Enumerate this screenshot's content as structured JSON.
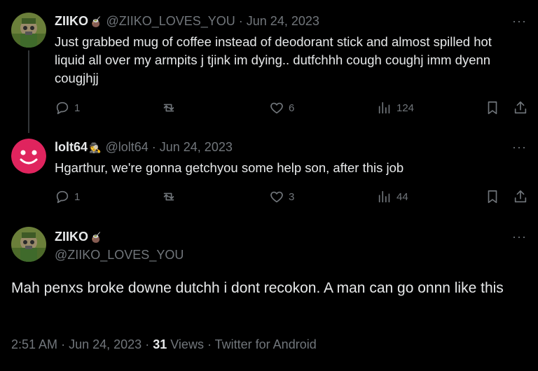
{
  "tweets": [
    {
      "name": "ZIIKO",
      "emoji": "🧉",
      "handle": "@ZIIKO_LOVES_YOU",
      "date": "Jun 24, 2023",
      "text": "Just grabbed mug of coffee instead of deodorant stick and almost spilled hot liquid all over my armpits j tjink im dying.. dutfchhh cough coughj imm dyenn cougjhjj",
      "replies": "1",
      "retweets": "",
      "likes": "6",
      "views": "124",
      "avatar_icon": "soldier-avatar-icon"
    },
    {
      "name": "lolt64",
      "emoji": "🕵",
      "handle": "@lolt64",
      "date": "Jun 24, 2023",
      "text": "Hgarthur, we're gonna getchyou some help son, after this job",
      "replies": "1",
      "retweets": "",
      "likes": "3",
      "views": "44",
      "avatar_icon": "smiley-face-avatar-icon"
    }
  ],
  "main_tweet": {
    "name": "ZIIKO",
    "emoji": "🧉",
    "handle": "@ZIIKO_LOVES_YOU",
    "text": "Mah penxs broke downe dutchh i dont recokon. A man can go onnn like this",
    "time": "2:51 AM",
    "date": "Jun 24, 2023",
    "views_count": "31",
    "views_label": "Views",
    "source": "Twitter for Android"
  },
  "more_glyph": "···",
  "sep": "·",
  "colors": {
    "background": "#000000",
    "text": "#e7e9ea",
    "muted": "#71767b",
    "smiley": "#e0245e"
  }
}
